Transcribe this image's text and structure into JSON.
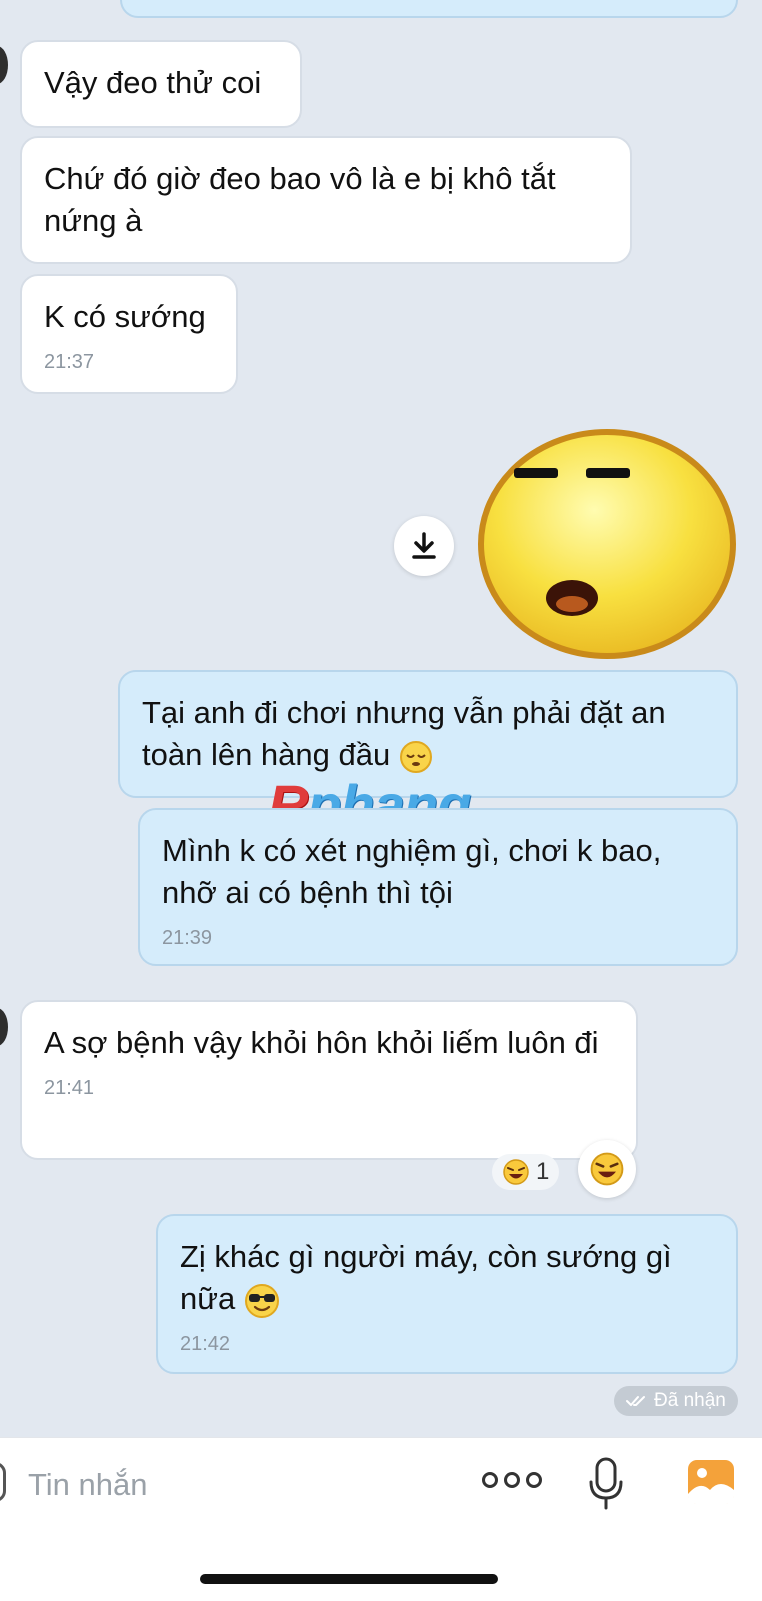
{
  "messages": [
    {
      "side": "in",
      "text": "Vậy đeo thử coi"
    },
    {
      "side": "in",
      "text": "Chứ đó giờ đeo bao vô là e bị khô tắt nứng à"
    },
    {
      "side": "in",
      "text": "K có sướng",
      "time": "21:37"
    },
    {
      "side": "out",
      "text": "Tại anh đi chơi nhưng vẫn phải đặt an toàn lên hàng đầu"
    },
    {
      "side": "out",
      "text": "Mình k có xét nghiệm gì, chơi k bao, nhỡ ai có bệnh thì tội",
      "time": "21:39"
    },
    {
      "side": "in",
      "text": "A sợ bệnh vậy khỏi hôn khỏi liếm luôn đi",
      "time": "21:41"
    },
    {
      "side": "out",
      "text": "Zị khác gì người máy, còn sướng gì nữa",
      "time": "21:42"
    }
  ],
  "sticker": {
    "icon": "sleepy-face-sticker"
  },
  "reaction": {
    "count": "1",
    "icon": "laughing-emoji-icon"
  },
  "status": {
    "label": "Đã nhận",
    "icon": "double-check-icon"
  },
  "watermark": {
    "prefix": "R",
    "rest": "phang"
  },
  "input": {
    "placeholder": "Tin nhắn"
  },
  "colors": {
    "incoming": "#ffffff",
    "outgoing": "#d5ecfb",
    "background": "#e2e8f0",
    "accent_image_icon": "#f4a23a"
  }
}
